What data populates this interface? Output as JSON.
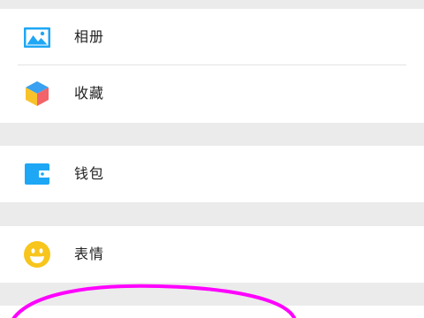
{
  "menu": {
    "album": {
      "label": "相册",
      "icon": "album-icon"
    },
    "favorites": {
      "label": "收藏",
      "icon": "favorites-cube-icon"
    },
    "wallet": {
      "label": "钱包",
      "icon": "wallet-icon"
    },
    "stickers": {
      "label": "表情",
      "icon": "emoji-smile-icon"
    }
  },
  "colors": {
    "background": "#ebebeb",
    "row": "#ffffff",
    "accent_blue": "#1ea7f5",
    "emoji_yellow": "#f7c51c",
    "annotation_magenta": "#ff00ff"
  }
}
